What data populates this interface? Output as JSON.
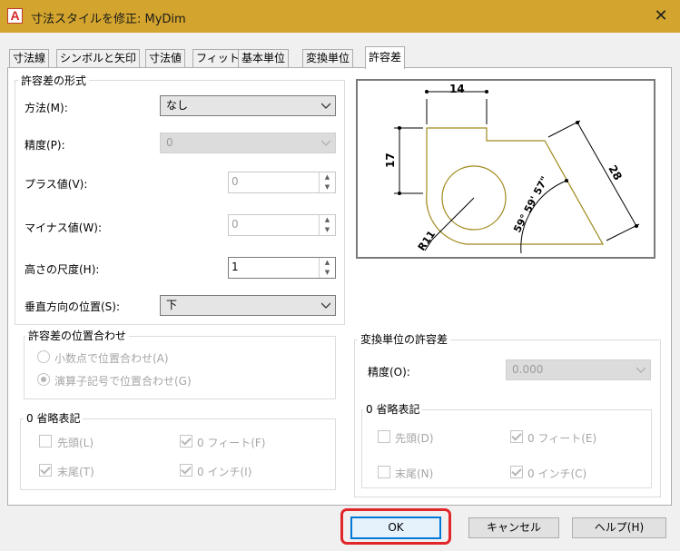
{
  "window": {
    "title": "寸法スタイルを修正: MyDim",
    "app_icon_letter": "A",
    "close_glyph": "✕"
  },
  "tabs": [
    "寸法線",
    "シンボルと矢印",
    "寸法値",
    "フィット",
    "基本単位",
    "変換単位",
    "許容差"
  ],
  "active_tab": "許容差",
  "format_group": {
    "title": "許容差の形式",
    "method_label": "方法(M):",
    "method_value": "なし",
    "precision_label": "精度(P):",
    "precision_value": "0",
    "plus_label": "プラス値(V):",
    "plus_value": "0",
    "minus_label": "マイナス値(W):",
    "minus_value": "0",
    "height_label": "高さの尺度(H):",
    "height_value": "1",
    "vpos_label": "垂直方向の位置(S):",
    "vpos_value": "下"
  },
  "alignment_group": {
    "title": "許容差の位置合わせ",
    "opt_decimal": "小数点で位置合わせ(A)",
    "opt_operator": "演算子記号で位置合わせ(G)"
  },
  "zero_group": {
    "title": "0 省略表記",
    "leading": "先頭(L)",
    "trailing": "末尾(T)",
    "feet": "0 フィート(F)",
    "inches": "0 インチ(I)"
  },
  "preview": {
    "dim_top": "14",
    "dim_left": "17",
    "dim_right": "28",
    "angle": "59° 59' 57\"",
    "radius": "R11"
  },
  "alt_group": {
    "title": "変換単位の許容差",
    "precision_label": "精度(O):",
    "precision_value": "0.000",
    "zero_title": "0 省略表記",
    "leading": "先頭(D)",
    "trailing": "末尾(N)",
    "feet": "0 フィート(E)",
    "inches": "0 インチ(C)"
  },
  "buttons": {
    "ok": "OK",
    "cancel": "キャンセル",
    "help": "ヘルプ(H)"
  },
  "colors": {
    "titlebar": "#d4a52e",
    "highlight_ring": "#e0262b",
    "geometry": "#a08a1c"
  }
}
